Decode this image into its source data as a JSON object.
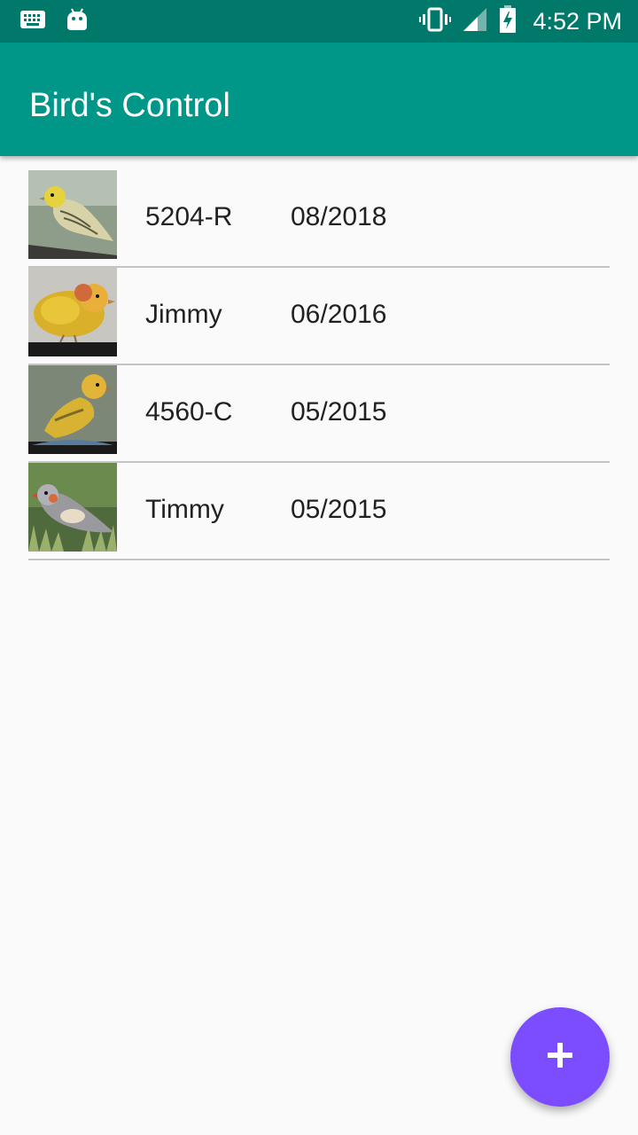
{
  "status_bar": {
    "time": "4:52 PM",
    "icons": [
      "keyboard-icon",
      "android-icon",
      "vibrate-icon",
      "signal-icon",
      "battery-charging-icon"
    ]
  },
  "app_bar": {
    "title": "Bird's Control",
    "color": "#009688"
  },
  "birds": [
    {
      "name": "5204-R",
      "date": "08/2018"
    },
    {
      "name": "Jimmy",
      "date": "06/2016"
    },
    {
      "name": "4560-C",
      "date": "05/2015"
    },
    {
      "name": "Timmy",
      "date": "05/2015"
    }
  ],
  "fab": {
    "icon": "plus-icon",
    "color": "#7c4dff"
  }
}
